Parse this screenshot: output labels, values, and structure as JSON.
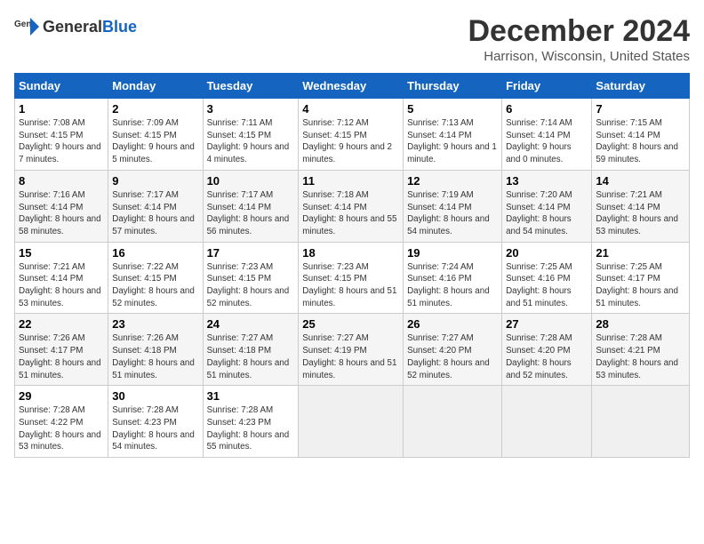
{
  "header": {
    "logo_general": "General",
    "logo_blue": "Blue",
    "title": "December 2024",
    "subtitle": "Harrison, Wisconsin, United States"
  },
  "weekdays": [
    "Sunday",
    "Monday",
    "Tuesday",
    "Wednesday",
    "Thursday",
    "Friday",
    "Saturday"
  ],
  "weeks": [
    [
      {
        "day": "1",
        "sunrise": "7:08 AM",
        "sunset": "4:15 PM",
        "daylight": "9 hours and 7 minutes."
      },
      {
        "day": "2",
        "sunrise": "7:09 AM",
        "sunset": "4:15 PM",
        "daylight": "9 hours and 5 minutes."
      },
      {
        "day": "3",
        "sunrise": "7:11 AM",
        "sunset": "4:15 PM",
        "daylight": "9 hours and 4 minutes."
      },
      {
        "day": "4",
        "sunrise": "7:12 AM",
        "sunset": "4:15 PM",
        "daylight": "9 hours and 2 minutes."
      },
      {
        "day": "5",
        "sunrise": "7:13 AM",
        "sunset": "4:14 PM",
        "daylight": "9 hours and 1 minute."
      },
      {
        "day": "6",
        "sunrise": "7:14 AM",
        "sunset": "4:14 PM",
        "daylight": "9 hours and 0 minutes."
      },
      {
        "day": "7",
        "sunrise": "7:15 AM",
        "sunset": "4:14 PM",
        "daylight": "8 hours and 59 minutes."
      }
    ],
    [
      {
        "day": "8",
        "sunrise": "7:16 AM",
        "sunset": "4:14 PM",
        "daylight": "8 hours and 58 minutes."
      },
      {
        "day": "9",
        "sunrise": "7:17 AM",
        "sunset": "4:14 PM",
        "daylight": "8 hours and 57 minutes."
      },
      {
        "day": "10",
        "sunrise": "7:17 AM",
        "sunset": "4:14 PM",
        "daylight": "8 hours and 56 minutes."
      },
      {
        "day": "11",
        "sunrise": "7:18 AM",
        "sunset": "4:14 PM",
        "daylight": "8 hours and 55 minutes."
      },
      {
        "day": "12",
        "sunrise": "7:19 AM",
        "sunset": "4:14 PM",
        "daylight": "8 hours and 54 minutes."
      },
      {
        "day": "13",
        "sunrise": "7:20 AM",
        "sunset": "4:14 PM",
        "daylight": "8 hours and 54 minutes."
      },
      {
        "day": "14",
        "sunrise": "7:21 AM",
        "sunset": "4:14 PM",
        "daylight": "8 hours and 53 minutes."
      }
    ],
    [
      {
        "day": "15",
        "sunrise": "7:21 AM",
        "sunset": "4:14 PM",
        "daylight": "8 hours and 53 minutes."
      },
      {
        "day": "16",
        "sunrise": "7:22 AM",
        "sunset": "4:15 PM",
        "daylight": "8 hours and 52 minutes."
      },
      {
        "day": "17",
        "sunrise": "7:23 AM",
        "sunset": "4:15 PM",
        "daylight": "8 hours and 52 minutes."
      },
      {
        "day": "18",
        "sunrise": "7:23 AM",
        "sunset": "4:15 PM",
        "daylight": "8 hours and 51 minutes."
      },
      {
        "day": "19",
        "sunrise": "7:24 AM",
        "sunset": "4:16 PM",
        "daylight": "8 hours and 51 minutes."
      },
      {
        "day": "20",
        "sunrise": "7:25 AM",
        "sunset": "4:16 PM",
        "daylight": "8 hours and 51 minutes."
      },
      {
        "day": "21",
        "sunrise": "7:25 AM",
        "sunset": "4:17 PM",
        "daylight": "8 hours and 51 minutes."
      }
    ],
    [
      {
        "day": "22",
        "sunrise": "7:26 AM",
        "sunset": "4:17 PM",
        "daylight": "8 hours and 51 minutes."
      },
      {
        "day": "23",
        "sunrise": "7:26 AM",
        "sunset": "4:18 PM",
        "daylight": "8 hours and 51 minutes."
      },
      {
        "day": "24",
        "sunrise": "7:27 AM",
        "sunset": "4:18 PM",
        "daylight": "8 hours and 51 minutes."
      },
      {
        "day": "25",
        "sunrise": "7:27 AM",
        "sunset": "4:19 PM",
        "daylight": "8 hours and 51 minutes."
      },
      {
        "day": "26",
        "sunrise": "7:27 AM",
        "sunset": "4:20 PM",
        "daylight": "8 hours and 52 minutes."
      },
      {
        "day": "27",
        "sunrise": "7:28 AM",
        "sunset": "4:20 PM",
        "daylight": "8 hours and 52 minutes."
      },
      {
        "day": "28",
        "sunrise": "7:28 AM",
        "sunset": "4:21 PM",
        "daylight": "8 hours and 53 minutes."
      }
    ],
    [
      {
        "day": "29",
        "sunrise": "7:28 AM",
        "sunset": "4:22 PM",
        "daylight": "8 hours and 53 minutes."
      },
      {
        "day": "30",
        "sunrise": "7:28 AM",
        "sunset": "4:23 PM",
        "daylight": "8 hours and 54 minutes."
      },
      {
        "day": "31",
        "sunrise": "7:28 AM",
        "sunset": "4:23 PM",
        "daylight": "8 hours and 55 minutes."
      },
      null,
      null,
      null,
      null
    ]
  ],
  "labels": {
    "sunrise": "Sunrise:",
    "sunset": "Sunset:",
    "daylight": "Daylight:"
  }
}
